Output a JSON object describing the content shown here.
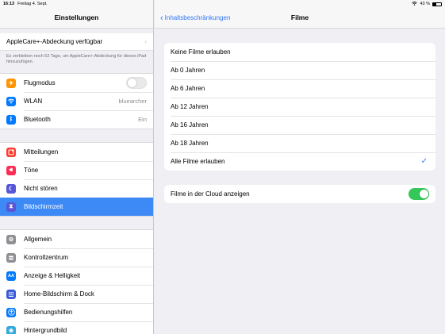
{
  "status": {
    "time": "16:13",
    "date": "Freitag 4. Sept.",
    "battery": "43 %",
    "battery_level": 0.43
  },
  "sidebar": {
    "title": "Einstellungen",
    "applecare": {
      "label": "AppleCare+-Abdeckung verfügbar",
      "note": "Es verbleiben noch 52 Tage, um AppleCare+-Abdeckung für dieses iPad hinzuzufügen."
    },
    "group1": [
      {
        "label": "Flugmodus",
        "icon": "airplane-icon",
        "color": "#ff9500"
      },
      {
        "label": "WLAN",
        "value": "bluearcher",
        "icon": "wifi-icon",
        "color": "#007aff"
      },
      {
        "label": "Bluetooth",
        "value": "Ein",
        "icon": "bluetooth-icon",
        "color": "#007aff"
      }
    ],
    "group2": [
      {
        "label": "Mitteilungen",
        "icon": "notifications-icon",
        "color": "#ff3b30"
      },
      {
        "label": "Töne",
        "icon": "sounds-icon",
        "color": "#ff2d55"
      },
      {
        "label": "Nicht stören",
        "icon": "moon-icon",
        "color": "#5856d6"
      },
      {
        "label": "Bildschirmzeit",
        "icon": "hourglass-icon",
        "color": "#5856d6"
      }
    ],
    "group3": [
      {
        "label": "Allgemein",
        "icon": "gear-icon",
        "color": "#8e8e93"
      },
      {
        "label": "Kontrollzentrum",
        "icon": "control-center-icon",
        "color": "#8e8e93"
      },
      {
        "label": "Anzeige & Helligkeit",
        "icon": "display-icon",
        "glyph": "AA",
        "color": "#007aff"
      },
      {
        "label": "Home-Bildschirm & Dock",
        "icon": "home-screen-icon",
        "color": "#3a5bd9"
      },
      {
        "label": "Bedienungshilfen",
        "icon": "accessibility-icon",
        "color": "#007aff"
      },
      {
        "label": "Hintergrundbild",
        "icon": "wallpaper-icon",
        "color": "#34aadc"
      }
    ]
  },
  "main": {
    "back_label": "Inhaltsbeschränkungen",
    "title": "Filme",
    "options": [
      "Keine Filme erlauben",
      "Ab 0 Jahren",
      "Ab 6 Jahren",
      "Ab 12 Jahren",
      "Ab 16 Jahren",
      "Ab 18 Jahren",
      "Alle Filme erlauben"
    ],
    "selected_option": "Alle Filme erlauben",
    "cloud_label": "Filme in der Cloud anzeigen"
  },
  "colors": {
    "accent": "#3478f6",
    "selected_row": "#3d8af7",
    "switch_on": "#34c759"
  }
}
